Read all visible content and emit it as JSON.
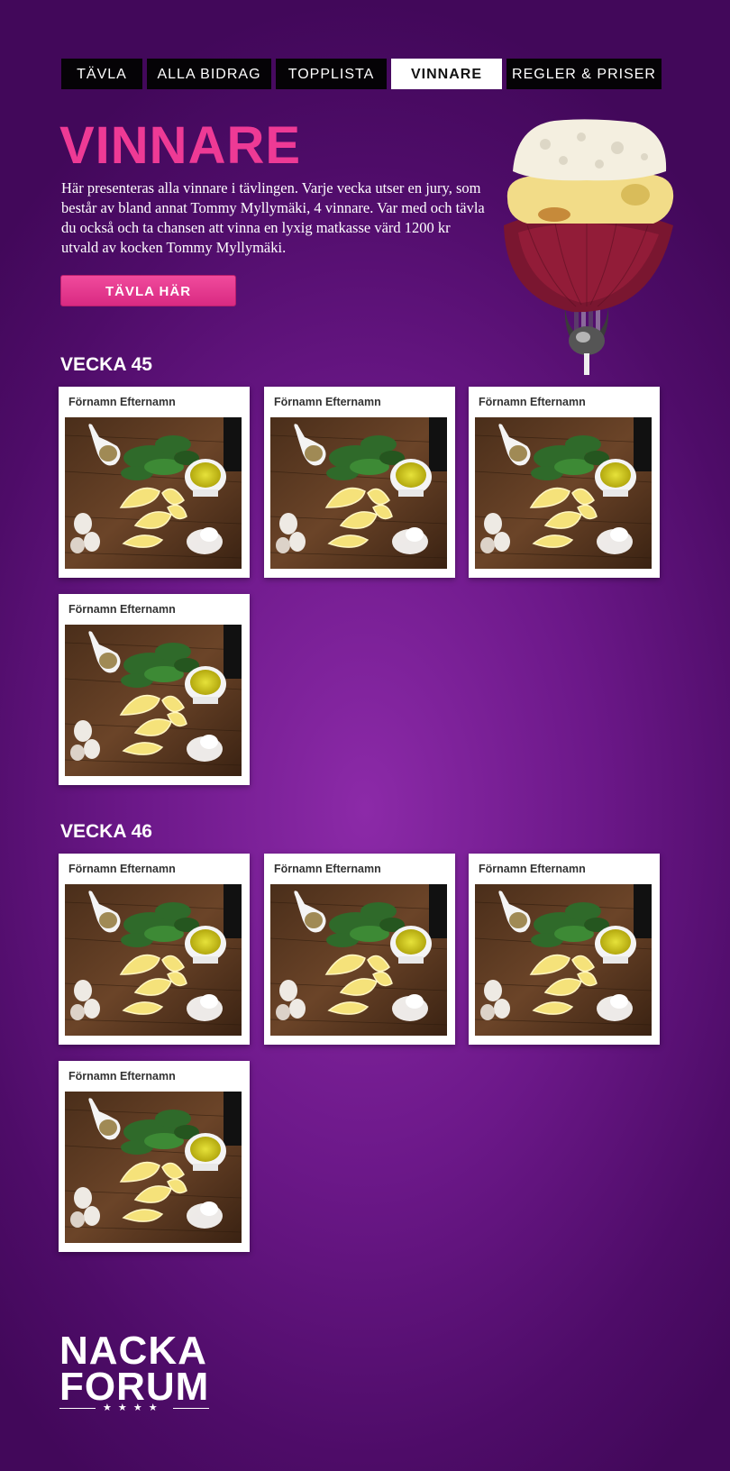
{
  "nav": [
    {
      "label": "TÄVLA",
      "active": false
    },
    {
      "label": "ALLA BIDRAG",
      "active": false
    },
    {
      "label": "TOPPLISTA",
      "active": false
    },
    {
      "label": "VINNARE",
      "active": true
    },
    {
      "label": "REGLER & PRISER",
      "active": false
    }
  ],
  "page": {
    "title": "VINNARE",
    "intro": "Här presenteras alla vinnare i tävlingen. Varje vecka utser en jury, som består av bland annat Tommy Myllymäki, 4 vinnare. Var med och tävla du också och ta chansen att vinna en lyxig matkasse värd 1200 kr utvald av kocken Tommy Myllymäki.",
    "cta_label": "TÄVLA HÄR"
  },
  "weeks": [
    {
      "title": "VECKA 45",
      "winners": [
        {
          "name": "Förnamn Efternamn"
        },
        {
          "name": "Förnamn Efternamn"
        },
        {
          "name": "Förnamn Efternamn"
        },
        {
          "name": "Förnamn Efternamn"
        }
      ]
    },
    {
      "title": "VECKA 46",
      "winners": [
        {
          "name": "Förnamn Efternamn"
        },
        {
          "name": "Förnamn Efternamn"
        },
        {
          "name": "Förnamn Efternamn"
        },
        {
          "name": "Förnamn Efternamn"
        }
      ]
    }
  ],
  "footer": {
    "logo_line1": "NACKA",
    "logo_line2": "FORUM",
    "logo_stars": "★ ★ ★ ★"
  },
  "colors": {
    "accent": "#ee3a95",
    "nav_bg": "#050306",
    "background": "#6c1889"
  }
}
